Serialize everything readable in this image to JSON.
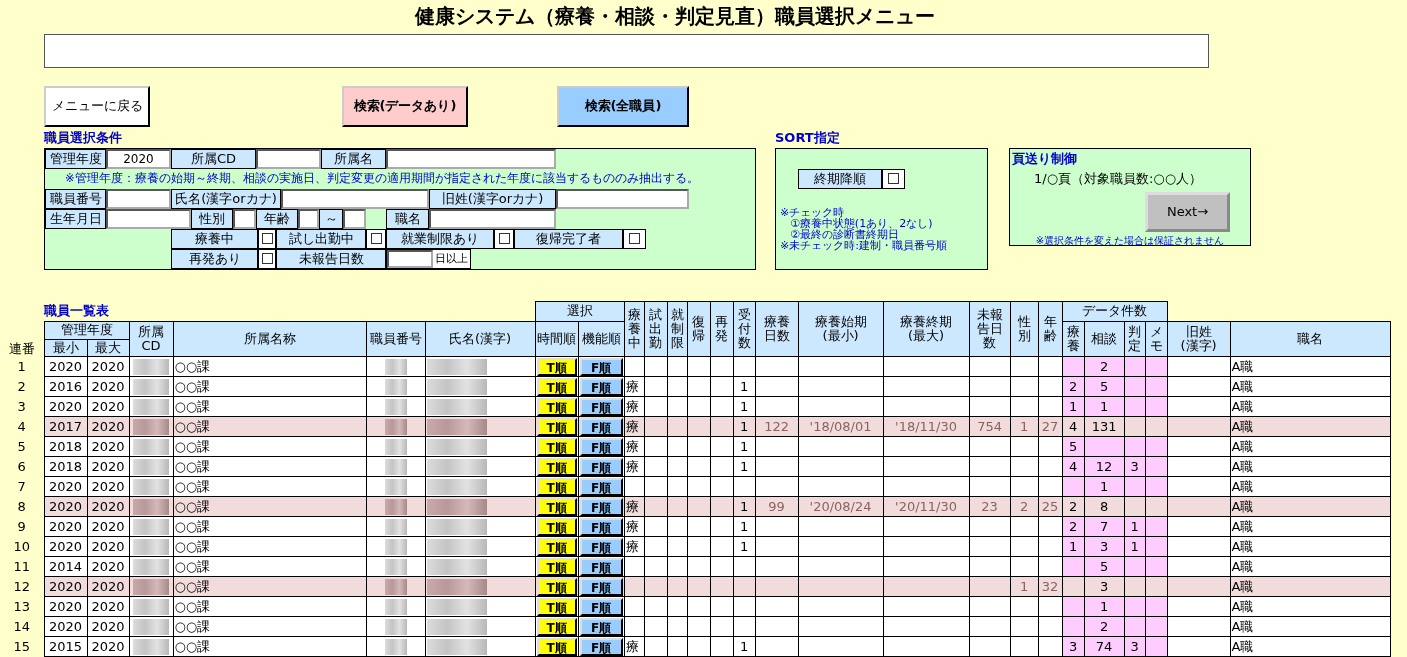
{
  "title": "健康システム（療養・相談・判定見直）職員選択メニュー",
  "buttons": [
    {
      "label": "メニューに戻る",
      "kind": "back"
    },
    {
      "label": "検索(データあり)",
      "kind": "search_data"
    },
    {
      "label": "検索(全職員)",
      "kind": "search_all"
    }
  ],
  "conditions": {
    "title": "職員選択条件",
    "rows": [
      [
        {
          "kind": "label",
          "text": "管理年度"
        },
        {
          "kind": "field",
          "value": "2020"
        },
        {
          "kind": "label",
          "text": "所属CD"
        },
        {
          "kind": "field"
        },
        {
          "kind": "label",
          "text": "所属名"
        },
        {
          "kind": "field"
        }
      ],
      [
        {
          "kind": "note",
          "text": "※管理年度：療養の始期～終期、相談の実施日、判定変更の適用期間が指定された年度に該当するもののみ抽出する。"
        }
      ],
      [
        {
          "kind": "label",
          "text": "職員番号"
        },
        {
          "kind": "field"
        },
        {
          "kind": "label",
          "text": "氏名(漢字orカナ)"
        },
        {
          "kind": "field"
        },
        {
          "kind": "label",
          "text": "旧姓(漢字orカナ)"
        },
        {
          "kind": "field"
        }
      ],
      [
        {
          "kind": "label",
          "text": "生年月日"
        },
        {
          "kind": "field"
        },
        {
          "kind": "label",
          "text": "性別"
        },
        {
          "kind": "field"
        },
        {
          "kind": "label",
          "text": "年齢"
        },
        {
          "kind": "field"
        },
        {
          "kind": "label",
          "text": "～"
        },
        {
          "kind": "field"
        },
        {
          "kind": "blank"
        },
        {
          "kind": "label",
          "text": "職名"
        },
        {
          "kind": "field"
        }
      ],
      [
        {
          "kind": "blank"
        },
        {
          "kind": "label",
          "text": "療養中"
        },
        {
          "kind": "checkbox",
          "checked": false
        },
        {
          "kind": "label",
          "text": "試し出勤中"
        },
        {
          "kind": "checkbox",
          "checked": false
        },
        {
          "kind": "label",
          "text": "就業制限あり"
        },
        {
          "kind": "checkbox",
          "checked": false
        },
        {
          "kind": "label",
          "text": "復帰完了者"
        },
        {
          "kind": "checkbox",
          "checked": false
        }
      ],
      [
        {
          "kind": "blank"
        },
        {
          "kind": "label",
          "text": "再発あり"
        },
        {
          "kind": "checkbox",
          "checked": false
        },
        {
          "kind": "label",
          "text": "未報告日数"
        },
        {
          "kind": "field_suffix",
          "suffix": "日以上"
        }
      ]
    ]
  },
  "sort": {
    "title": "SORT指定",
    "option": {
      "label": "終期降順",
      "checked": false
    },
    "notes": [
      "※チェック時",
      "①療養中状態(1あり、2なし)",
      "②最終の診断書終期日",
      "※未チェック時:建制・職員番号順"
    ]
  },
  "paging": {
    "title": "頁送り制御",
    "status": "1/○頁（対象職員数:○○人）",
    "button": "Next→",
    "note": "※選択条件を変えた場合は保証されません"
  },
  "table": {
    "title": "職員一覧表",
    "index_header": "連番",
    "year_header": {
      "label": "管理年度",
      "columns": [
        "最小",
        "最大"
      ]
    },
    "info_headers": [
      "所属CD",
      "所属名称",
      "職員番号",
      "氏名(漢字)"
    ],
    "select_header": {
      "label": "選択",
      "columns": [
        "時間順",
        "機能順"
      ]
    },
    "status_headers": [
      "療養中",
      "試出勤",
      "就制限",
      "復帰",
      "再発",
      "受付数",
      "療養日数",
      "療養始期(最小)",
      "療養終期(最大)",
      "未報告日数",
      "性別",
      "年齢"
    ],
    "count_header": {
      "label": "データ件数",
      "columns": [
        "療養",
        "相談",
        "判定",
        "メモ"
      ]
    },
    "tail_headers": [
      "旧姓(漢字)",
      "職名"
    ],
    "rows": [
      {
        "no": "1",
        "min": "2020",
        "max": "2020",
        "dept": "○○課",
        "t": "T順",
        "f": "F順",
        "highlighted": false,
        "cc": "2",
        "job": "A職"
      },
      {
        "no": "2",
        "min": "2016",
        "max": "2020",
        "dept": "○○課",
        "t": "T順",
        "f": "F順",
        "highlighted": false,
        "treat": "療",
        "recv": "1",
        "cr": "2",
        "cc": "5",
        "job": "A職"
      },
      {
        "no": "3",
        "min": "2020",
        "max": "2020",
        "dept": "○○課",
        "t": "T順",
        "f": "F順",
        "highlighted": false,
        "treat": "療",
        "recv": "1",
        "cr": "1",
        "cc": "1",
        "job": "A職"
      },
      {
        "no": "4",
        "min": "2017",
        "max": "2020",
        "dept": "○○課",
        "t": "T順",
        "f": "F順",
        "highlighted": true,
        "treat": "療",
        "recv": "1",
        "days": "122",
        "start": "'18/08/01",
        "end": "'18/11/30",
        "unrep": "754",
        "sex": "1",
        "age": "27",
        "cr": "4",
        "cc": "131",
        "job": "A職"
      },
      {
        "no": "5",
        "min": "2018",
        "max": "2020",
        "dept": "○○課",
        "t": "T順",
        "f": "F順",
        "highlighted": false,
        "treat": "療",
        "recv": "1",
        "cr": "5",
        "job": "A職"
      },
      {
        "no": "6",
        "min": "2018",
        "max": "2020",
        "dept": "○○課",
        "t": "T順",
        "f": "F順",
        "highlighted": false,
        "treat": "療",
        "recv": "1",
        "cr": "4",
        "cc": "12",
        "cj": "3",
        "job": "A職"
      },
      {
        "no": "7",
        "min": "2020",
        "max": "2020",
        "dept": "○○課",
        "t": "T順",
        "f": "F順",
        "highlighted": false,
        "cc": "1",
        "job": "A職"
      },
      {
        "no": "8",
        "min": "2020",
        "max": "2020",
        "dept": "○○課",
        "t": "T順",
        "f": "F順",
        "highlighted": true,
        "treat": "療",
        "recv": "1",
        "days": "99",
        "start": "'20/08/24",
        "end": "'20/11/30",
        "unrep": "23",
        "sex": "2",
        "age": "25",
        "cr": "2",
        "cc": "8",
        "job": "A職"
      },
      {
        "no": "9",
        "min": "2020",
        "max": "2020",
        "dept": "○○課",
        "t": "T順",
        "f": "F順",
        "highlighted": false,
        "treat": "療",
        "recv": "1",
        "cr": "2",
        "cc": "7",
        "cj": "1",
        "job": "A職"
      },
      {
        "no": "10",
        "min": "2020",
        "max": "2020",
        "dept": "○○課",
        "t": "T順",
        "f": "F順",
        "highlighted": false,
        "treat": "療",
        "recv": "1",
        "cr": "1",
        "cc": "3",
        "cj": "1",
        "job": "A職"
      },
      {
        "no": "11",
        "min": "2014",
        "max": "2020",
        "dept": "○○課",
        "t": "T順",
        "f": "F順",
        "highlighted": false,
        "cc": "5",
        "job": "A職"
      },
      {
        "no": "12",
        "min": "2020",
        "max": "2020",
        "dept": "○○課",
        "t": "T順",
        "f": "F順",
        "highlighted": true,
        "sex": "1",
        "age": "32",
        "cc": "3",
        "job": "A職"
      },
      {
        "no": "13",
        "min": "2020",
        "max": "2020",
        "dept": "○○課",
        "t": "T順",
        "f": "F順",
        "highlighted": false,
        "cc": "1",
        "job": "A職"
      },
      {
        "no": "14",
        "min": "2020",
        "max": "2020",
        "dept": "○○課",
        "t": "T順",
        "f": "F順",
        "highlighted": false,
        "cc": "2",
        "job": "A職"
      },
      {
        "no": "15",
        "min": "2015",
        "max": "2020",
        "dept": "○○課",
        "t": "T順",
        "f": "F順",
        "highlighted": false,
        "treat": "療",
        "recv": "1",
        "cr": "3",
        "cc": "74",
        "cj": "3",
        "job": "A職"
      }
    ]
  }
}
